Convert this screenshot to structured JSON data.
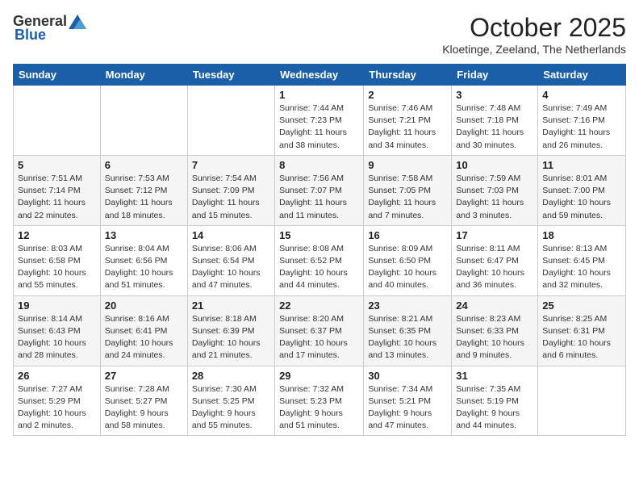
{
  "header": {
    "logo_general": "General",
    "logo_blue": "Blue",
    "title": "October 2025",
    "location": "Kloetinge, Zeeland, The Netherlands"
  },
  "weekdays": [
    "Sunday",
    "Monday",
    "Tuesday",
    "Wednesday",
    "Thursday",
    "Friday",
    "Saturday"
  ],
  "weeks": [
    [
      {
        "day": "",
        "info": ""
      },
      {
        "day": "",
        "info": ""
      },
      {
        "day": "",
        "info": ""
      },
      {
        "day": "1",
        "info": "Sunrise: 7:44 AM\nSunset: 7:23 PM\nDaylight: 11 hours\nand 38 minutes."
      },
      {
        "day": "2",
        "info": "Sunrise: 7:46 AM\nSunset: 7:21 PM\nDaylight: 11 hours\nand 34 minutes."
      },
      {
        "day": "3",
        "info": "Sunrise: 7:48 AM\nSunset: 7:18 PM\nDaylight: 11 hours\nand 30 minutes."
      },
      {
        "day": "4",
        "info": "Sunrise: 7:49 AM\nSunset: 7:16 PM\nDaylight: 11 hours\nand 26 minutes."
      }
    ],
    [
      {
        "day": "5",
        "info": "Sunrise: 7:51 AM\nSunset: 7:14 PM\nDaylight: 11 hours\nand 22 minutes."
      },
      {
        "day": "6",
        "info": "Sunrise: 7:53 AM\nSunset: 7:12 PM\nDaylight: 11 hours\nand 18 minutes."
      },
      {
        "day": "7",
        "info": "Sunrise: 7:54 AM\nSunset: 7:09 PM\nDaylight: 11 hours\nand 15 minutes."
      },
      {
        "day": "8",
        "info": "Sunrise: 7:56 AM\nSunset: 7:07 PM\nDaylight: 11 hours\nand 11 minutes."
      },
      {
        "day": "9",
        "info": "Sunrise: 7:58 AM\nSunset: 7:05 PM\nDaylight: 11 hours\nand 7 minutes."
      },
      {
        "day": "10",
        "info": "Sunrise: 7:59 AM\nSunset: 7:03 PM\nDaylight: 11 hours\nand 3 minutes."
      },
      {
        "day": "11",
        "info": "Sunrise: 8:01 AM\nSunset: 7:00 PM\nDaylight: 10 hours\nand 59 minutes."
      }
    ],
    [
      {
        "day": "12",
        "info": "Sunrise: 8:03 AM\nSunset: 6:58 PM\nDaylight: 10 hours\nand 55 minutes."
      },
      {
        "day": "13",
        "info": "Sunrise: 8:04 AM\nSunset: 6:56 PM\nDaylight: 10 hours\nand 51 minutes."
      },
      {
        "day": "14",
        "info": "Sunrise: 8:06 AM\nSunset: 6:54 PM\nDaylight: 10 hours\nand 47 minutes."
      },
      {
        "day": "15",
        "info": "Sunrise: 8:08 AM\nSunset: 6:52 PM\nDaylight: 10 hours\nand 44 minutes."
      },
      {
        "day": "16",
        "info": "Sunrise: 8:09 AM\nSunset: 6:50 PM\nDaylight: 10 hours\nand 40 minutes."
      },
      {
        "day": "17",
        "info": "Sunrise: 8:11 AM\nSunset: 6:47 PM\nDaylight: 10 hours\nand 36 minutes."
      },
      {
        "day": "18",
        "info": "Sunrise: 8:13 AM\nSunset: 6:45 PM\nDaylight: 10 hours\nand 32 minutes."
      }
    ],
    [
      {
        "day": "19",
        "info": "Sunrise: 8:14 AM\nSunset: 6:43 PM\nDaylight: 10 hours\nand 28 minutes."
      },
      {
        "day": "20",
        "info": "Sunrise: 8:16 AM\nSunset: 6:41 PM\nDaylight: 10 hours\nand 24 minutes."
      },
      {
        "day": "21",
        "info": "Sunrise: 8:18 AM\nSunset: 6:39 PM\nDaylight: 10 hours\nand 21 minutes."
      },
      {
        "day": "22",
        "info": "Sunrise: 8:20 AM\nSunset: 6:37 PM\nDaylight: 10 hours\nand 17 minutes."
      },
      {
        "day": "23",
        "info": "Sunrise: 8:21 AM\nSunset: 6:35 PM\nDaylight: 10 hours\nand 13 minutes."
      },
      {
        "day": "24",
        "info": "Sunrise: 8:23 AM\nSunset: 6:33 PM\nDaylight: 10 hours\nand 9 minutes."
      },
      {
        "day": "25",
        "info": "Sunrise: 8:25 AM\nSunset: 6:31 PM\nDaylight: 10 hours\nand 6 minutes."
      }
    ],
    [
      {
        "day": "26",
        "info": "Sunrise: 7:27 AM\nSunset: 5:29 PM\nDaylight: 10 hours\nand 2 minutes."
      },
      {
        "day": "27",
        "info": "Sunrise: 7:28 AM\nSunset: 5:27 PM\nDaylight: 9 hours\nand 58 minutes."
      },
      {
        "day": "28",
        "info": "Sunrise: 7:30 AM\nSunset: 5:25 PM\nDaylight: 9 hours\nand 55 minutes."
      },
      {
        "day": "29",
        "info": "Sunrise: 7:32 AM\nSunset: 5:23 PM\nDaylight: 9 hours\nand 51 minutes."
      },
      {
        "day": "30",
        "info": "Sunrise: 7:34 AM\nSunset: 5:21 PM\nDaylight: 9 hours\nand 47 minutes."
      },
      {
        "day": "31",
        "info": "Sunrise: 7:35 AM\nSunset: 5:19 PM\nDaylight: 9 hours\nand 44 minutes."
      },
      {
        "day": "",
        "info": ""
      }
    ]
  ]
}
